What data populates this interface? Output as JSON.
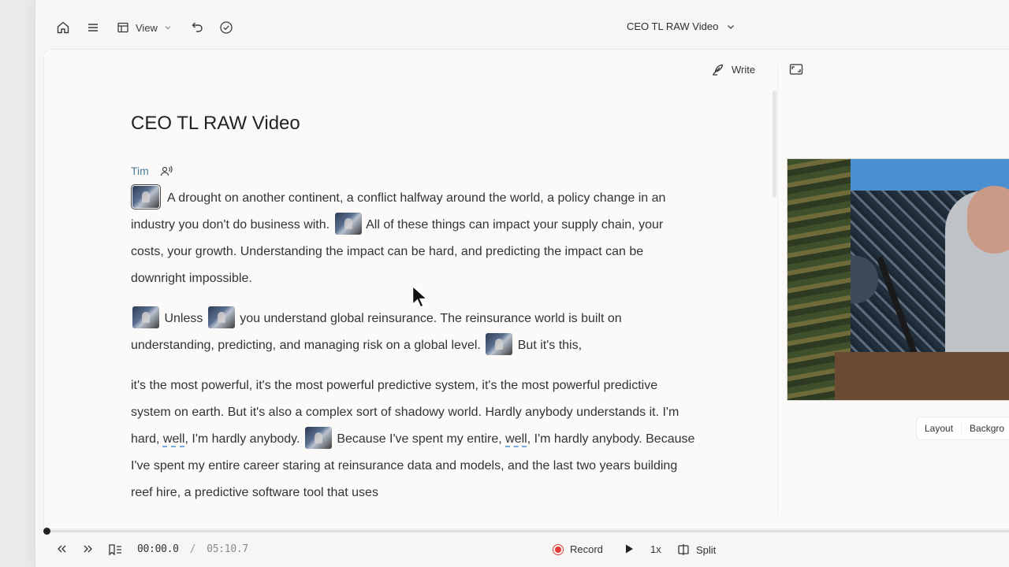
{
  "topbar": {
    "view_label": "View",
    "document_title": "CEO TL RAW Video"
  },
  "editor": {
    "write_label": "Write",
    "title": "CEO TL RAW Video",
    "speaker": "Tim",
    "paragraphs": [
      {
        "segments": [
          "A drought on another continent, a conflict halfway around the world, a policy change in an industry you don't do business with.",
          "All of these things can impact your supply chain, your costs, your growth. Understanding the impact can be hard, and predicting the impact can be downright impossible."
        ]
      },
      {
        "segments": [
          "Unless",
          "you understand global reinsurance. The reinsurance world is built on understanding, predicting, and managing risk on a global level.",
          "But it's this,"
        ]
      },
      {
        "segments": [
          "it's the most powerful, it's the most powerful predictive system, it's the most powerful predictive system on earth. But it's also a complex sort of shadowy world. Hardly anybody understands it. I'm hard,",
          "well",
          ", I'm hardly anybody.",
          "Because I've spent my entire,",
          "well",
          ",",
          "I'm hardly anybody. Because I've spent my entire career staring at reinsurance data and models, and the last two years building reef hire, a predictive software tool that uses"
        ]
      }
    ]
  },
  "preview": {
    "layout_label": "Layout",
    "background_label": "Backgro"
  },
  "player": {
    "current_time": "00:00.0",
    "separator": "/",
    "total_time": "05:10.7",
    "record_label": "Record",
    "speed_label": "1x",
    "split_label": "Split"
  }
}
